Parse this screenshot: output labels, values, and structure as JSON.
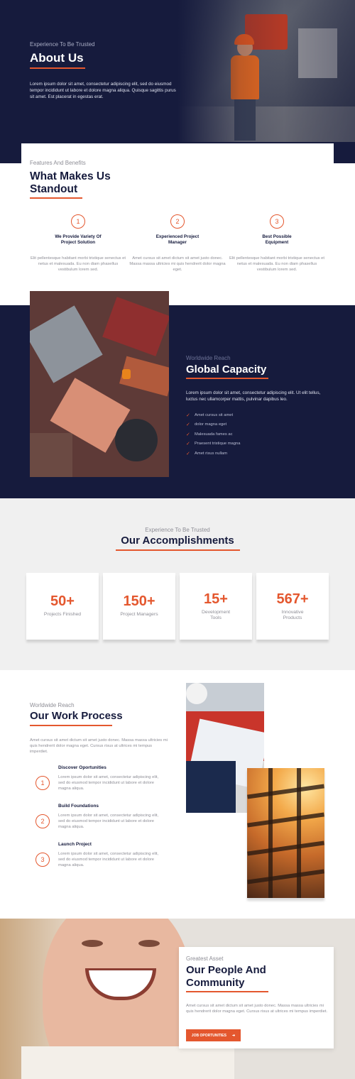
{
  "colors": {
    "navy": "#161b3d",
    "accent": "#e4572e",
    "light_bg": "#f0f0f0"
  },
  "hero": {
    "eyebrow": "Experience To Be Trusted",
    "title": "About Us",
    "text": "Lorem ipsum dolor sit amet, consectetur adipiscing elit, sed do eiusmod tempor incididunt ut labore et dolore magna aliqua. Quisque sagittis purus sit amet. Est placerat in egestas erat."
  },
  "features": {
    "eyebrow": "Features And Benefits",
    "title_line1": "What Makes Us",
    "title_line2": "Standout",
    "items": [
      {
        "num": "1",
        "title_line1": "We Provide Variety Of",
        "title_line2": "Project Solution",
        "text": "Elit pellentesque habitant morbi tristique senectus et netus et malesuada. Eu non diam phasellus vestibulum lorem sed."
      },
      {
        "num": "2",
        "title_line1": "Experienced Project",
        "title_line2": "Manager",
        "text": "Amet cursus sit amet dictum sit amet justo donec. Massa massa ultricies mi quis hendrerit dolor magna eget."
      },
      {
        "num": "3",
        "title_line1": "Best Possible",
        "title_line2": "Equipment",
        "text": "Elit pellentesque habitant morbi tristique senectus et netus et malesuada. Eu non diam phasellus vestibulum lorem sed."
      }
    ]
  },
  "capacity": {
    "eyebrow": "Worldwide Reach",
    "title": "Global Capacity",
    "text": "Lorem ipsum dolor sit amet, consectetur adipiscing elit. Ut elit tellus, luctus nec ullamcorper mattis, pulvinar dapibus leo.",
    "list": [
      "Amet cursus sit amet",
      "dolor magna eget",
      "Malesuada fames ac",
      "Praesent tristique magna",
      "Amet risus nullam"
    ]
  },
  "accomplishments": {
    "eyebrow": "Experience To Be Trusted",
    "title": "Our Accomplishments",
    "stats": [
      {
        "value": "50+",
        "label_line1": "Projects Finished",
        "label_line2": ""
      },
      {
        "value": "150+",
        "label_line1": "Project Managers",
        "label_line2": ""
      },
      {
        "value": "15+",
        "label_line1": "Development",
        "label_line2": "Tools"
      },
      {
        "value": "567+",
        "label_line1": "Innovative",
        "label_line2": "Products"
      }
    ]
  },
  "process": {
    "eyebrow": "Worldwide Reach",
    "title": "Our Work Process",
    "intro": "Amet cursus sit amet dictum sit amet justo donec. Massa massa ultricies mi quis hendrerit dolor magna eget. Cursus risus at ultrices mi tempus imperdiet.",
    "steps": [
      {
        "num": "1",
        "title": "Discover Oportunities",
        "text": "Lorem ipsum dolor sit amet, consectetur adipiscing elit, sed do eiusmod tempor incididunt ut labore et dolore magna aliqua."
      },
      {
        "num": "2",
        "title": "Build Foundations",
        "text": "Lorem ipsum dolor sit amet, consectetur adipiscing elit, sed do eiusmod tempor incididunt ut labore et dolore magna aliqua."
      },
      {
        "num": "3",
        "title": "Launch Project",
        "text": "Lorem ipsum dolor sit amet, consectetur adipiscing elit, sed do eiusmod tempor incididunt ut labore et dolore magna aliqua."
      }
    ]
  },
  "people": {
    "eyebrow": "Greatest Asset",
    "title_line1": "Our People And",
    "title_line2": "Community",
    "text": "Amet cursus sit amet dictum sit amet justo donec. Massa massa ultricies mi quis hendrerit dolor magna eget. Cursus risus at ultrices mi tempus imperdiet.",
    "button_label": "JOB OPORTUNITIES",
    "button_icon": "arrow-right-icon"
  }
}
